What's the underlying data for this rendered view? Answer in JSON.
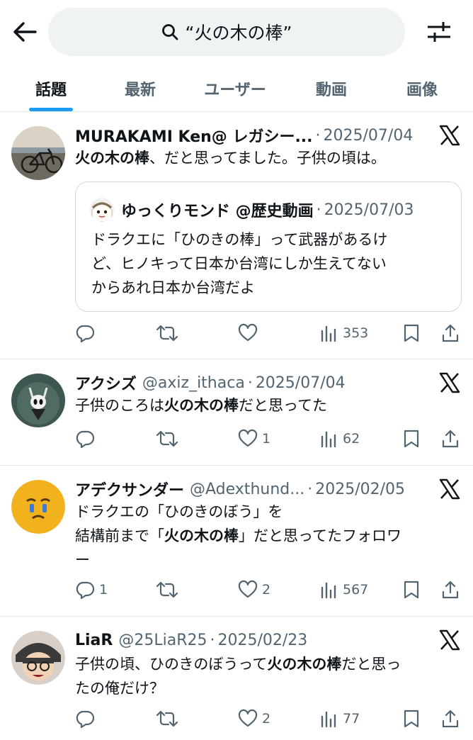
{
  "search": {
    "query": "“火の木の棒”"
  },
  "tabs": [
    {
      "label": "話題"
    },
    {
      "label": "最新"
    },
    {
      "label": "ユーザー"
    },
    {
      "label": "動画"
    },
    {
      "label": "画像"
    }
  ],
  "tweets": [
    {
      "name": "MURAKAMI Ken@ レガシー...",
      "handle": "",
      "date": "2025/07/04",
      "text_pre": "",
      "text_bold": "火の木の棒",
      "text_post": "、だと思ってました。子供の頃は。",
      "quote": {
        "name": "ゆっくりモンド @歴史動画",
        "date": "2025/07/03",
        "line1": "ドラクエに「ひのきの棒」って武器があるけ",
        "line2": "ど、ヒノキって日本か台湾にしか生えてない",
        "line3": "からあれ日本か台湾だよ"
      },
      "replies": "",
      "likes": "",
      "views": "353"
    },
    {
      "name": "アクシズ",
      "handle": "@axiz_ithaca",
      "date": "2025/07/04",
      "text_pre": "子供のころは",
      "text_bold": "火の木の棒",
      "text_post": "だと思ってた",
      "replies": "",
      "likes": "1",
      "views": "62"
    },
    {
      "name": "アデクサンダー",
      "handle": "@Adexthund...",
      "date": "2025/02/05",
      "line1": "ドラクエの「ひのきのぼう」を",
      "line2_pre": "結構前まで「",
      "line2_bold": "火の木の棒",
      "line2_post": "」だと思ってたフォロワ",
      "line3": "ー",
      "replies": "1",
      "likes": "2",
      "views": "567"
    },
    {
      "name": "LiaR",
      "handle": "@25LiaR25",
      "date": "2025/02/23",
      "line1_pre": "子供の頃、ひのきのぼうって",
      "line1_bold": "火の木の棒",
      "line1_post": "だと思っ",
      "line2": "たの俺だけ？",
      "replies": "",
      "likes": "2",
      "views": "77"
    }
  ],
  "colors": {
    "accent": "#1d9bf0",
    "text": "#0f1419",
    "secondary": "#536471"
  }
}
